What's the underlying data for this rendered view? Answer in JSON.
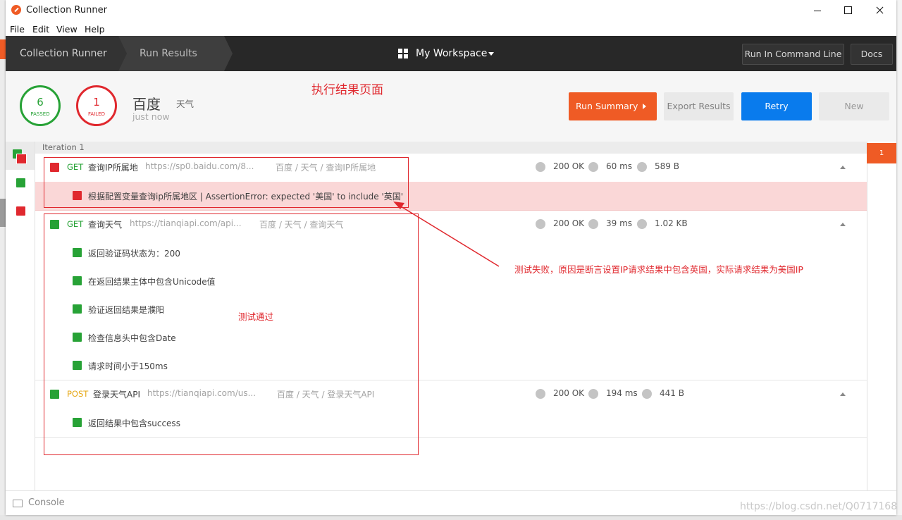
{
  "window": {
    "title": "Collection Runner"
  },
  "menu": [
    "File",
    "Edit",
    "View",
    "Help"
  ],
  "header": {
    "crumbs": [
      "Collection Runner",
      "Run Results"
    ],
    "workspace": "My Workspace",
    "command_line": "Run In Command Line",
    "docs": "Docs"
  },
  "summary": {
    "passed_count": "6",
    "passed_label": "PASSED",
    "failed_count": "1",
    "failed_label": "FAILED",
    "collection": "百度",
    "environment": "天气",
    "time": "just now"
  },
  "actions": {
    "run_summary": "Run Summary",
    "export": "Export Results",
    "retry": "Retry",
    "new": "New"
  },
  "iteration_label": "Iteration 1",
  "requests": [
    {
      "method": "GET",
      "name": "查询IP所属地",
      "url": "https://sp0.baidu.com/8...",
      "path": "百度 / 天气 / 查询IP所属地",
      "status": "200 OK",
      "time": "60 ms",
      "size": "589 B",
      "result": "fail",
      "tests": [
        {
          "name": "根据配置变量查询ip所属地区 | AssertionError: expected '美国' to include '英国'",
          "result": "fail"
        }
      ]
    },
    {
      "method": "GET",
      "name": "查询天气",
      "url": "https://tianqiapi.com/api...",
      "path": "百度 / 天气 / 查询天气",
      "status": "200 OK",
      "time": "39 ms",
      "size": "1.02 KB",
      "result": "pass",
      "tests": [
        {
          "name": "返回验证码状态为：200",
          "result": "pass"
        },
        {
          "name": "在返回结果主体中包含Unicode值",
          "result": "pass"
        },
        {
          "name": "验证返回结果是濮阳",
          "result": "pass"
        },
        {
          "name": "检查信息头中包含Date",
          "result": "pass"
        },
        {
          "name": "请求时间小于150ms",
          "result": "pass"
        }
      ]
    },
    {
      "method": "POST",
      "name": "登录天气API",
      "url": "https://tianqiapi.com/us...",
      "path": "百度 / 天气 / 登录天气API",
      "status": "200 OK",
      "time": "194 ms",
      "size": "441 B",
      "result": "pass",
      "tests": [
        {
          "name": "返回结果中包含success",
          "result": "pass"
        }
      ]
    }
  ],
  "right_badge": "1",
  "console": "Console",
  "annotations": {
    "page_title": "执行结果页面",
    "fail_note": "测试失败，原因是断言设置IP请求结果中包含英国，实际请求结果为美国IP",
    "pass_note": "测试通过"
  },
  "watermark": "https://blog.csdn.net/Q0717168",
  "colors": {
    "accent_orange": "#ef5b25",
    "pass_green": "#27a236",
    "fail_red": "#e0282e",
    "retry_blue": "#097bed",
    "method_get": "#27a236",
    "method_post": "#e6a817",
    "header_dark": "#282828"
  }
}
